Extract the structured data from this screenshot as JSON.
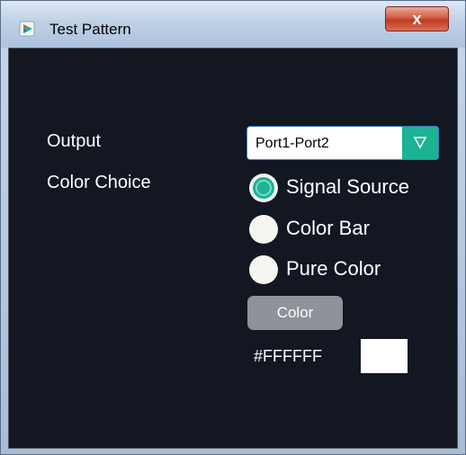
{
  "window": {
    "title": "Test Pattern",
    "close_label": "x"
  },
  "form": {
    "output_label": "Output",
    "output_value": "Port1-Port2",
    "color_choice_label": "Color Choice",
    "options": [
      {
        "label": "Signal Source",
        "selected": true
      },
      {
        "label": "Color Bar",
        "selected": false
      },
      {
        "label": "Pure Color",
        "selected": false
      }
    ],
    "color_button_label": "Color",
    "color_hex": "#FFFFFF",
    "swatch_color": "#FFFFFF"
  },
  "colors": {
    "accent": "#1BB394",
    "background": "#121722",
    "button_gray": "#8E9399",
    "close_red": "#C0391F"
  },
  "icons": {
    "app": "app-icon",
    "dropdown": "triangle-down-icon"
  }
}
